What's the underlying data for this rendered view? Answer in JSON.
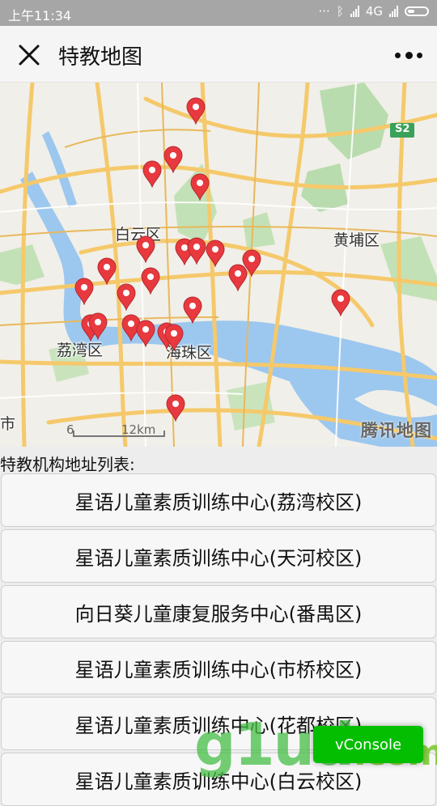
{
  "status_bar": {
    "time": "上午11:34",
    "network": "4G"
  },
  "nav": {
    "title": "特教地图",
    "close_icon": "close-icon",
    "more_icon": "more-icon"
  },
  "map": {
    "labels": {
      "baiyun": "白云区",
      "huangpu": "黄埔区",
      "liwan": "荔湾区",
      "haizhu": "海珠区",
      "shi": "市",
      "scale_label": "12km",
      "scale_tick": "6"
    },
    "logo": "腾讯地图",
    "highway_label": "S2",
    "marker_icon": "map-pin-icon",
    "marker_count": 24,
    "colors": {
      "road": "#f5c96b",
      "water": "#9cc7ef",
      "green": "#b9dcae",
      "marker": "#e8393f"
    }
  },
  "list": {
    "heading": "特教机构地址列表:",
    "items": [
      "星语儿童素质训练中心(荔湾校区)",
      "星语儿童素质训练中心(天河校区)",
      "向日葵儿童康复服务中心(番禺区)",
      "星语儿童素质训练中心(市桥校区)",
      "星语儿童素质训练中心(花都校区)",
      "星语儿童素质训练中心(白云校区)"
    ]
  },
  "overlay": {
    "vconsole_label": "vConsole"
  }
}
